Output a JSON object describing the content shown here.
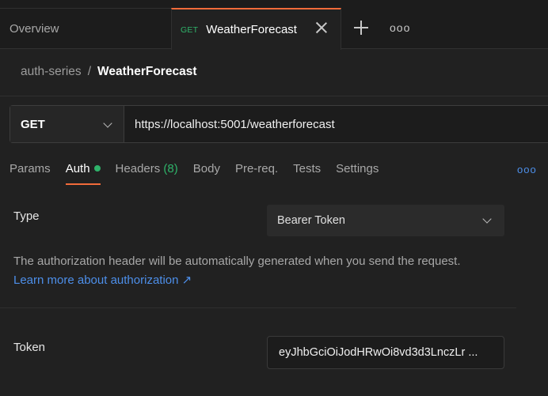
{
  "tabs": {
    "overview_label": "Overview",
    "active": {
      "method": "GET",
      "title": "WeatherForecast",
      "method_color": "#2fb36a"
    },
    "accent": "#f26b3a"
  },
  "icons": {
    "close": "close-icon",
    "add": "plus-icon",
    "more": "ellipsis-icon",
    "dropdown": "chevron-down-icon",
    "external": "arrow-up-right-icon"
  },
  "breadcrumb": {
    "parent": "auth-series",
    "separator": "/",
    "current": "WeatherForecast"
  },
  "request": {
    "method": "GET",
    "url": "https://localhost:5001/weatherforecast"
  },
  "request_tabs": [
    {
      "label": "Params"
    },
    {
      "label": "Auth",
      "active": true,
      "indicator": true
    },
    {
      "label": "Headers",
      "count": "(8)"
    },
    {
      "label": "Body"
    },
    {
      "label": "Pre-req."
    },
    {
      "label": "Tests"
    },
    {
      "label": "Settings"
    }
  ],
  "auth": {
    "type_label": "Type",
    "type_value": "Bearer Token",
    "description": "The authorization header will be automatically generated when you send the request.",
    "learn_more": "Learn more about authorization ↗",
    "link_color": "#4d8fea",
    "token_label": "Token",
    "token_value": "eyJhbGciOiJodHRwOi8vd3d3LnczLr ..."
  }
}
